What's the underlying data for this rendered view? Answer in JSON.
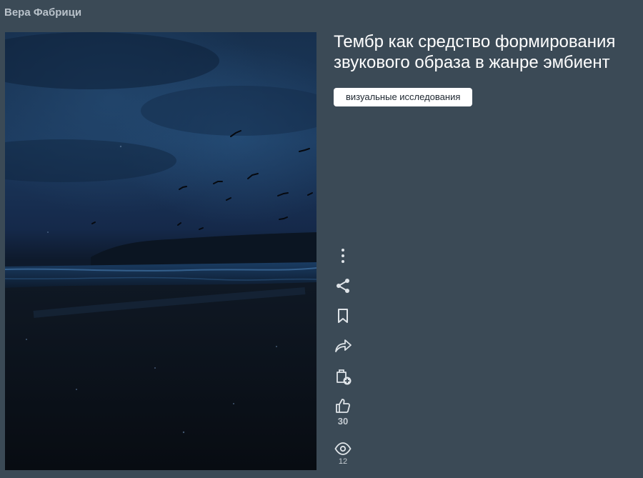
{
  "author": {
    "name": "Вера Фабрици"
  },
  "project": {
    "title": "Тембр как средство формирования звукового образа в жанре эмбиент",
    "tag": "визуальные исследования"
  },
  "actions": {
    "more": {
      "icon": "more-vertical-icon"
    },
    "share": {
      "icon": "share-icon"
    },
    "bookmark": {
      "icon": "bookmark-icon"
    },
    "repost": {
      "icon": "forward-arrow-icon"
    },
    "collection": {
      "icon": "add-to-collection-icon"
    },
    "like": {
      "icon": "thumbs-up-icon",
      "count": "30"
    },
    "views": {
      "icon": "eye-icon",
      "count": "12"
    }
  },
  "colors": {
    "background": "#3b4a56",
    "tag_background": "#ffffff",
    "icon": "#dfe4e8"
  }
}
